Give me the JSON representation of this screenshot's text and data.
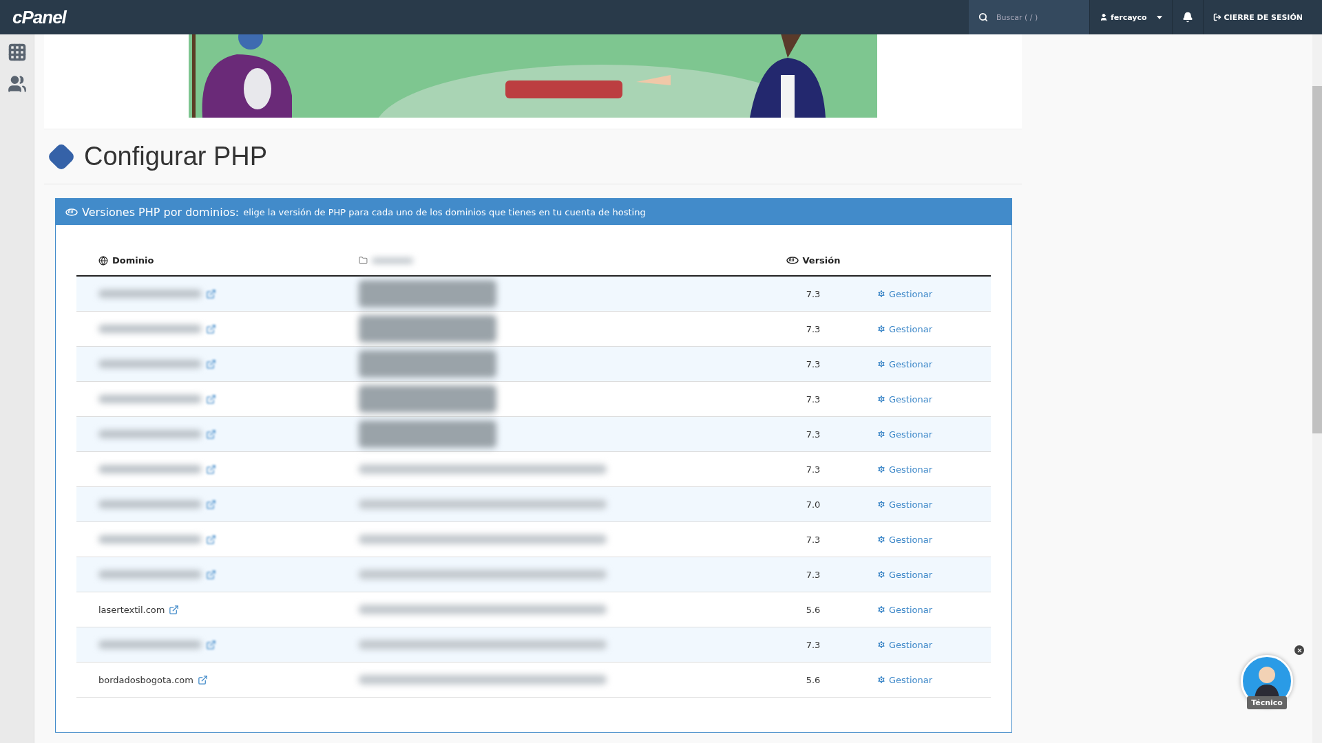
{
  "topbar": {
    "logo": "cPanel",
    "search": {
      "placeholder": "Buscar ( / )"
    },
    "user": "fercayco",
    "logout": "CIERRE DE SESIÓN"
  },
  "page_title": "Configurar PHP",
  "panel": {
    "heading": "Versiones PHP por dominios:",
    "description": "elige la versión de PHP para cada uno de los dominios que tienes en tu cuenta de hosting",
    "columns": [
      {
        "label": "Dominio",
        "kind": "domain"
      },
      {
        "kind": "redacted"
      },
      {
        "label": "Versión",
        "kind": "version"
      }
    ],
    "rows": [
      {
        "redacted": true,
        "version": "7.3",
        "action": "Gestionar"
      },
      {
        "redacted": true,
        "version": "7.3",
        "action": "Gestionar"
      },
      {
        "redacted": true,
        "version": "7.3",
        "action": "Gestionar"
      },
      {
        "redacted": true,
        "version": "7.3",
        "action": "Gestionar"
      },
      {
        "redacted": true,
        "version": "7.3",
        "action": "Gestionar"
      },
      {
        "redacted": true,
        "version": "7.3",
        "action": "Gestionar"
      },
      {
        "redacted": true,
        "version": "7.0",
        "action": "Gestionar"
      },
      {
        "redacted": true,
        "version": "7.3",
        "action": "Gestionar"
      },
      {
        "redacted": true,
        "version": "7.3",
        "action": "Gestionar"
      },
      {
        "domain": "lasertextil.com",
        "redacted": false,
        "version": "5.6",
        "action": "Gestionar"
      },
      {
        "redacted": true,
        "version": "7.3",
        "action": "Gestionar"
      },
      {
        "domain": "bordadosbogota.com",
        "redacted": false,
        "version": "5.6",
        "action": "Gestionar"
      }
    ]
  },
  "chat_widget": {
    "label": "Técnico"
  }
}
